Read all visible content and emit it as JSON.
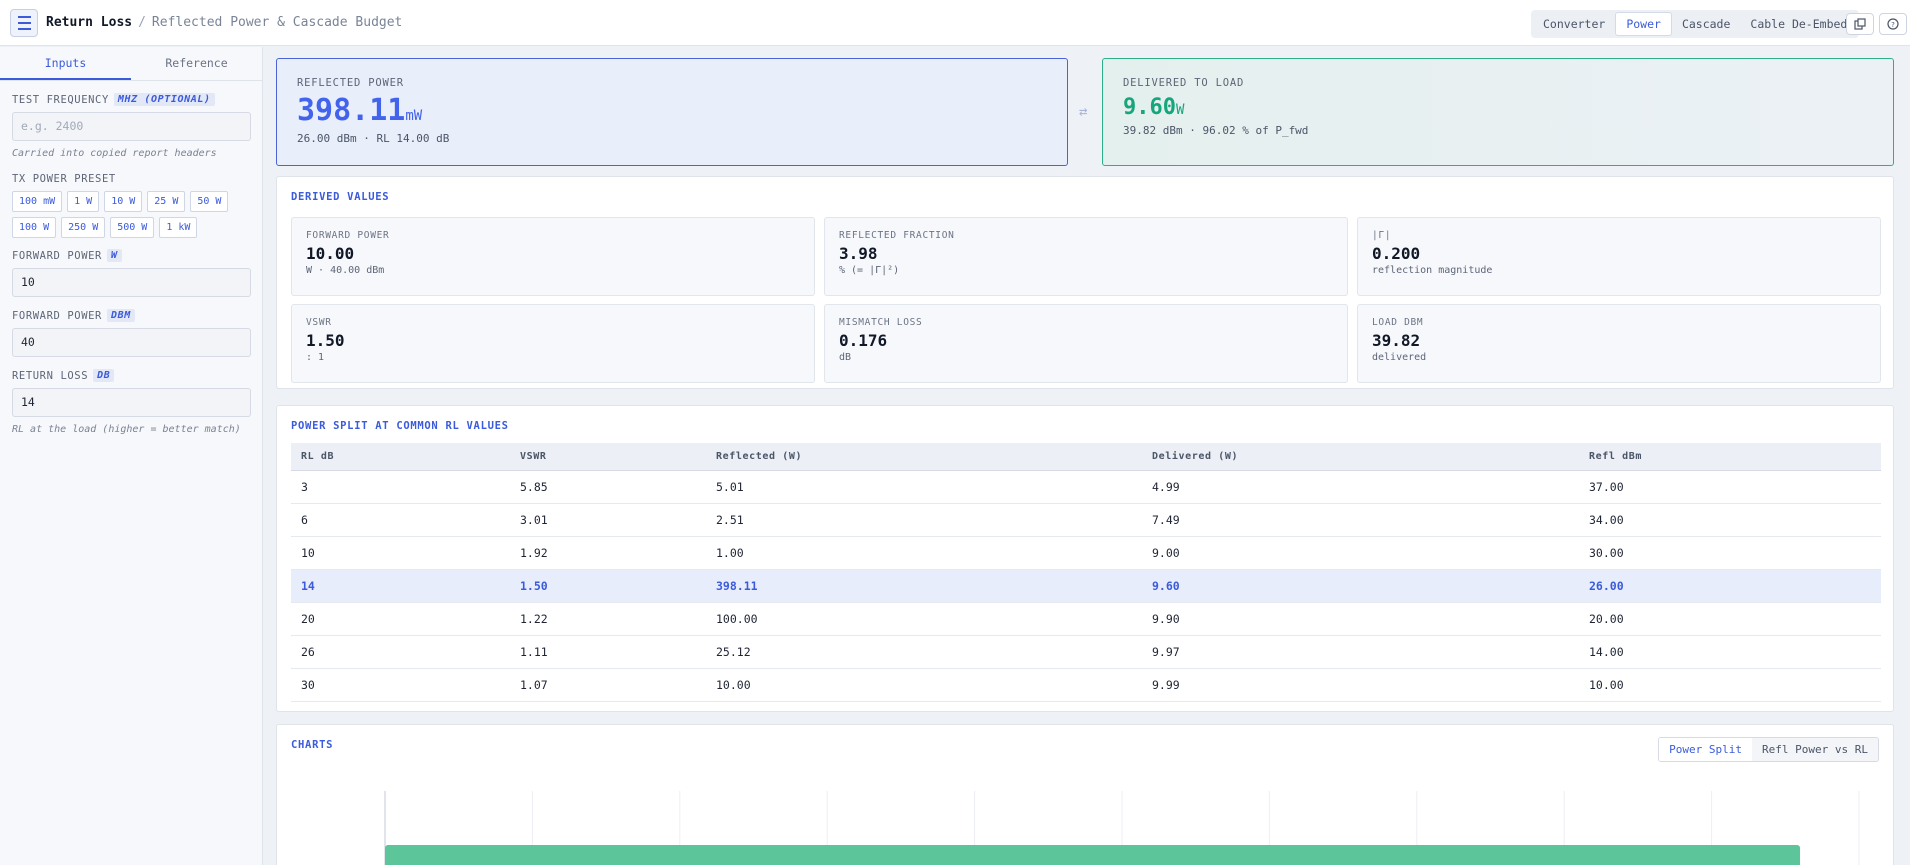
{
  "header": {
    "title": "Return Loss",
    "separator": "/",
    "subtitle": "Reflected Power & Cascade Budget",
    "tabs": [
      "Converter",
      "Power",
      "Cascade",
      "Cable De-Embed"
    ],
    "active_tab": "Power"
  },
  "sidebar": {
    "tabs": [
      "Inputs",
      "Reference"
    ],
    "test_frequency": {
      "label": "Test Frequency",
      "unit": "MHz (optional)",
      "placeholder": "e.g. 2400",
      "hint": "Carried into copied report headers"
    },
    "tx_power_preset": {
      "label": "TX Power Preset",
      "presets": [
        "100 mW",
        "1 W",
        "10 W",
        "25 W",
        "50 W",
        "100 W",
        "250 W",
        "500 W",
        "1 kW"
      ]
    },
    "forward_power_w": {
      "label": "Forward Power",
      "unit": "W",
      "value": "10"
    },
    "forward_power_dbm": {
      "label": "Forward Power",
      "unit": "dBm",
      "value": "40"
    },
    "return_loss": {
      "label": "Return Loss",
      "unit": "dB",
      "value": "14",
      "hint": "RL at the load (higher = better match)"
    }
  },
  "hero": {
    "reflected": {
      "label": "Reflected Power",
      "value": "398.11",
      "unit": "mW",
      "sub": "26.00 dBm · RL 14.00 dB"
    },
    "swap_icon": "⇄",
    "delivered": {
      "label": "Delivered to Load",
      "value": "9.60",
      "unit": "W",
      "sub": "39.82 dBm · 96.02 % of P_fwd"
    }
  },
  "derived": {
    "title": "Derived Values",
    "items": [
      {
        "label": "Forward Power",
        "value": "10.00",
        "sub": "W · 40.00 dBm"
      },
      {
        "label": "Reflected Fraction",
        "value": "3.98",
        "sub": "% (= |Γ|²)"
      },
      {
        "label": "|Γ|",
        "value": "0.200",
        "sub": "reflection magnitude"
      },
      {
        "label": "VSWR",
        "value": "1.50",
        "sub": ": 1"
      },
      {
        "label": "Mismatch Loss",
        "value": "0.176",
        "sub": "dB"
      },
      {
        "label": "Load dBm",
        "value": "39.82",
        "sub": "delivered"
      }
    ]
  },
  "split": {
    "title": "Power Split at Common RL Values",
    "columns": [
      "RL dB",
      "VSWR",
      "Reflected (W)",
      "Delivered (W)",
      "Refl dBm"
    ],
    "rows": [
      [
        "3",
        "5.85",
        "5.01",
        "4.99",
        "37.00"
      ],
      [
        "6",
        "3.01",
        "2.51",
        "7.49",
        "34.00"
      ],
      [
        "10",
        "1.92",
        "1.00",
        "9.00",
        "30.00"
      ],
      [
        "14",
        "1.50",
        "398.11",
        "9.60",
        "26.00"
      ],
      [
        "20",
        "1.22",
        "100.00",
        "9.90",
        "20.00"
      ],
      [
        "26",
        "1.11",
        "25.12",
        "9.97",
        "14.00"
      ],
      [
        "30",
        "1.07",
        "10.00",
        "9.99",
        "10.00"
      ]
    ],
    "highlight_row": 3
  },
  "charts": {
    "title": "Charts",
    "tabs": [
      "Power Split",
      "Refl Power vs RL"
    ],
    "active_tab": "Power Split"
  },
  "chart_data": {
    "type": "bar",
    "orientation": "horizontal",
    "series": [
      {
        "values": [
          9.6
        ],
        "color": "#5cc59a"
      }
    ],
    "grid": true
  }
}
